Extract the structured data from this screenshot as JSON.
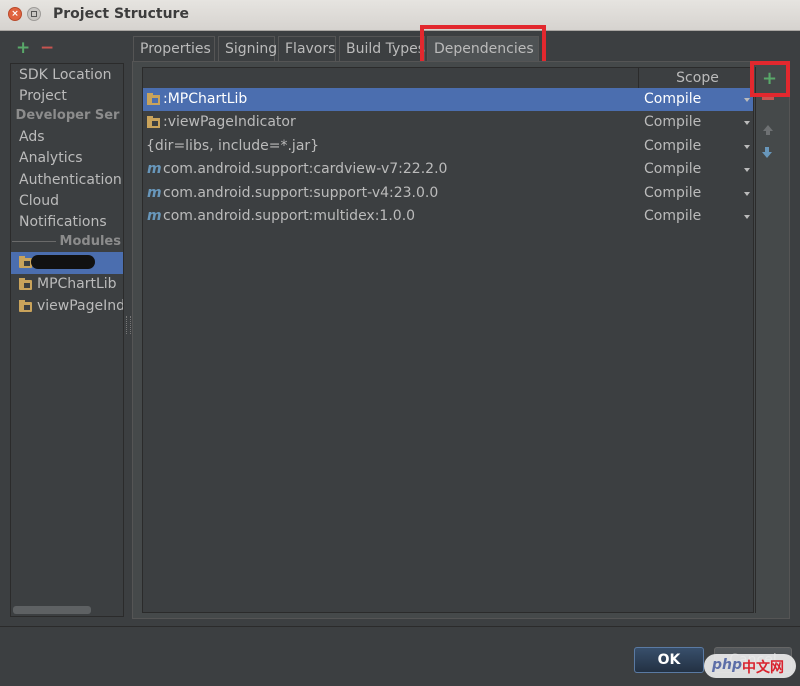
{
  "window": {
    "title": "Project Structure",
    "close_glyph": "×"
  },
  "left": {
    "add": "+",
    "remove": "−",
    "items_top": [
      "SDK Location",
      "Project"
    ],
    "section_dev": "Developer Ser",
    "items_dev": [
      "Ads",
      "Analytics",
      "Authentication",
      "Cloud",
      "Notifications"
    ],
    "section_modules": "Modules",
    "modules": [
      "MPChartLib",
      "viewPageInd"
    ]
  },
  "tabs": [
    "Properties",
    "Signing",
    "Flavors",
    "Build Types",
    "Dependencies"
  ],
  "table": {
    "header_scope": "Scope",
    "icon_m": "m",
    "rows": [
      {
        "name": ":MPChartLib",
        "scope": "Compile"
      },
      {
        "name": ":viewPageIndicator",
        "scope": "Compile"
      },
      {
        "name": "{dir=libs, include=*.jar}",
        "scope": "Compile"
      },
      {
        "name": "com.android.support:cardview-v7:22.2.0",
        "scope": "Compile"
      },
      {
        "name": "com.android.support:support-v4:23.0.0",
        "scope": "Compile"
      },
      {
        "name": "com.android.support:multidex:1.0.0",
        "scope": "Compile"
      }
    ]
  },
  "toolbar": {
    "add": "+"
  },
  "buttons": {
    "ok": "OK",
    "cancel": "Cancel"
  },
  "watermark": {
    "php": "php",
    "cn": "中文网"
  },
  "colors": {
    "selection": "#4b6eaf",
    "highlight": "#e2282e",
    "add": "#59a869",
    "remove": "#c75450"
  }
}
